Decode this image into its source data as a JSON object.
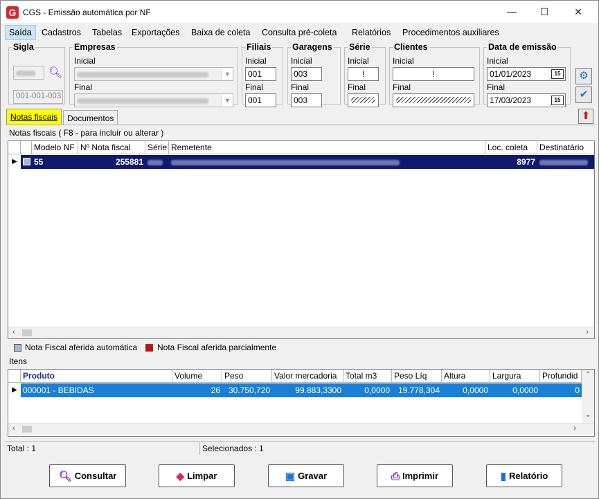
{
  "window": {
    "title": "CGS - Emissão automática por NF",
    "minimize": "—",
    "maximize": "☐",
    "close": "✕"
  },
  "menu": [
    "Saída",
    "Cadastros",
    "Tabelas",
    "Exportações",
    "Baixa de coleta",
    "Consulta pré-coleta",
    "Relatórios",
    "Procedimentos auxiliares"
  ],
  "filters": {
    "sigla": {
      "legend": "Sigla",
      "value2": "001-001-003"
    },
    "empresas": {
      "legend": "Empresas",
      "inicial": "Inicial",
      "final": "Final"
    },
    "filiais": {
      "legend": "Filiais",
      "inicial_label": "Inicial",
      "inicial": "001",
      "final_label": "Final",
      "final": "001"
    },
    "garagens": {
      "legend": "Garagens",
      "inicial_label": "Inicial",
      "inicial": "003",
      "final_label": "Final",
      "final": "003"
    },
    "serie": {
      "legend": "Série",
      "inicial_label": "Inicial",
      "inicial": "!",
      "final_label": "Final"
    },
    "clientes": {
      "legend": "Clientes",
      "inicial_label": "Inicial",
      "inicial": "!",
      "final_label": "Final"
    },
    "data": {
      "legend": "Data de emissão",
      "inicial_label": "Inicial",
      "inicial": "01/01/2023",
      "final_label": "Final",
      "final": "17/03/2023",
      "cal": "15"
    }
  },
  "tabs": [
    "Notas fiscais",
    "Documentos"
  ],
  "notas": {
    "caption": "Notas fiscais ( F8 - para incluir ou alterar )",
    "columns": [
      "Modelo NF",
      "Nº Nota fiscal",
      "Série",
      "Remetente",
      "Loc. coleta",
      "Destinatário"
    ],
    "row": {
      "modelo": "55",
      "numero": "255881",
      "loc": "8977"
    },
    "legend1": "Nota Fiscal aferida automática",
    "legend2": "Nota Fiscal aferida parcialmente"
  },
  "itens": {
    "caption": "Itens",
    "columns": [
      "Produto",
      "Volume",
      "Peso",
      "Valor mercadoria",
      "Total m3",
      "Peso Líq",
      "Altura",
      "Largura",
      "Profundid"
    ],
    "row": [
      "000001 - BEBIDAS",
      "26",
      "30.750,720",
      "99.883,3300",
      "0,0000",
      "19.778,304",
      "0,0000",
      "0,0000",
      "0"
    ]
  },
  "status": {
    "total": "Total : 1",
    "selecionados": "Selecionados : 1"
  },
  "buttons": {
    "consultar": "Consultar",
    "limpar": "Limpar",
    "gravar": "Gravar",
    "imprimir": "Imprimir",
    "relatorio": "Relatório"
  },
  "colors": {
    "selection": "#0f1a6e",
    "item_selection": "#1a7fd6",
    "legend_auto": "#a9b7c9",
    "legend_parcial": "#e00000",
    "tab_active": "#ffff00"
  }
}
